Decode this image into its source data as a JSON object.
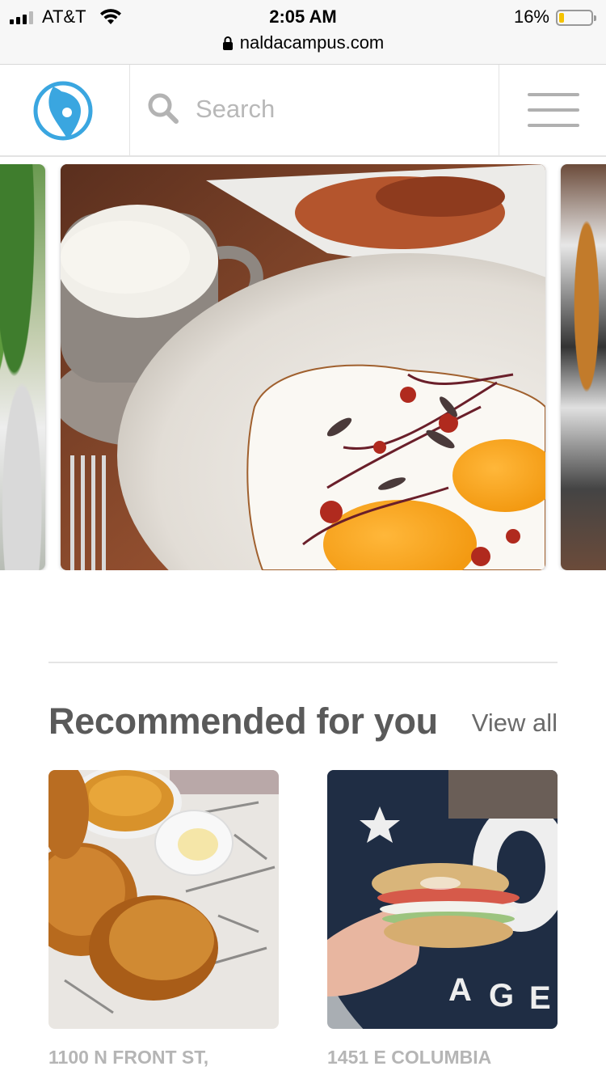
{
  "status_bar": {
    "carrier": "AT&T",
    "time": "2:05 AM",
    "battery_percent": "16%",
    "battery_level": 0.16,
    "url": "naldacampus.com"
  },
  "header": {
    "logo": "compass-pin-logo",
    "search_placeholder": "Search",
    "menu": "hamburger-menu-icon"
  },
  "carousel": {
    "slides": [
      {
        "image": "salad-and-soup-photo"
      },
      {
        "image": "fried-eggs-and-latte-photo"
      },
      {
        "image": "fried-chicken-photo"
      }
    ]
  },
  "recommended": {
    "title": "Recommended for you",
    "view_all_label": "View all",
    "items": [
      {
        "address": "1100 N FRONT ST,",
        "image": "fried-chicken-cornbread-photo"
      },
      {
        "address": "1451 E COLUMBIA",
        "image": "bagel-sandwich-photo"
      }
    ]
  },
  "colors": {
    "brand_blue": "#3aa6e0",
    "title_gray": "#5a5a5a",
    "address_gray": "#b5b5b5",
    "battery_yellow": "#f5c300"
  }
}
